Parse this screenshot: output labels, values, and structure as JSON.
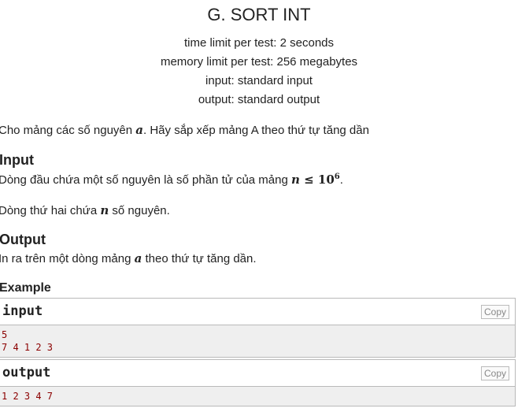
{
  "problem": {
    "title": "G. SORT INT",
    "time_limit": "time limit per test: 2 seconds",
    "memory_limit": "memory limit per test: 256 megabytes",
    "input_spec": "input: standard input",
    "output_spec": "output: standard output"
  },
  "statement": {
    "text_before": "Cho mảng các số nguyên ",
    "var_a": "a",
    "text_after": ". Hãy sắp xếp mảng A theo thứ tự tăng dần"
  },
  "input_section": {
    "heading": "Input",
    "line1_before": "Dòng đầu chứa một số nguyên là số phần tử của mảng ",
    "line1_var": "n",
    "line1_op": " ≤ 10",
    "line1_exp": "6",
    "line1_after": ".",
    "line2_before": "Dòng thứ hai chứa ",
    "line2_var": "n",
    "line2_after": " số nguyên."
  },
  "output_section": {
    "heading": "Output",
    "line_before": "In ra trên một dòng mảng ",
    "line_var": "a",
    "line_after": " theo thứ tự tăng dần."
  },
  "example": {
    "heading": "Example",
    "input_title": "input",
    "input_lines": [
      "5",
      "7 4 1 2 3"
    ],
    "output_title": "output",
    "output_lines": [
      "1 2 3 4 7"
    ],
    "copy_label": "Copy"
  }
}
